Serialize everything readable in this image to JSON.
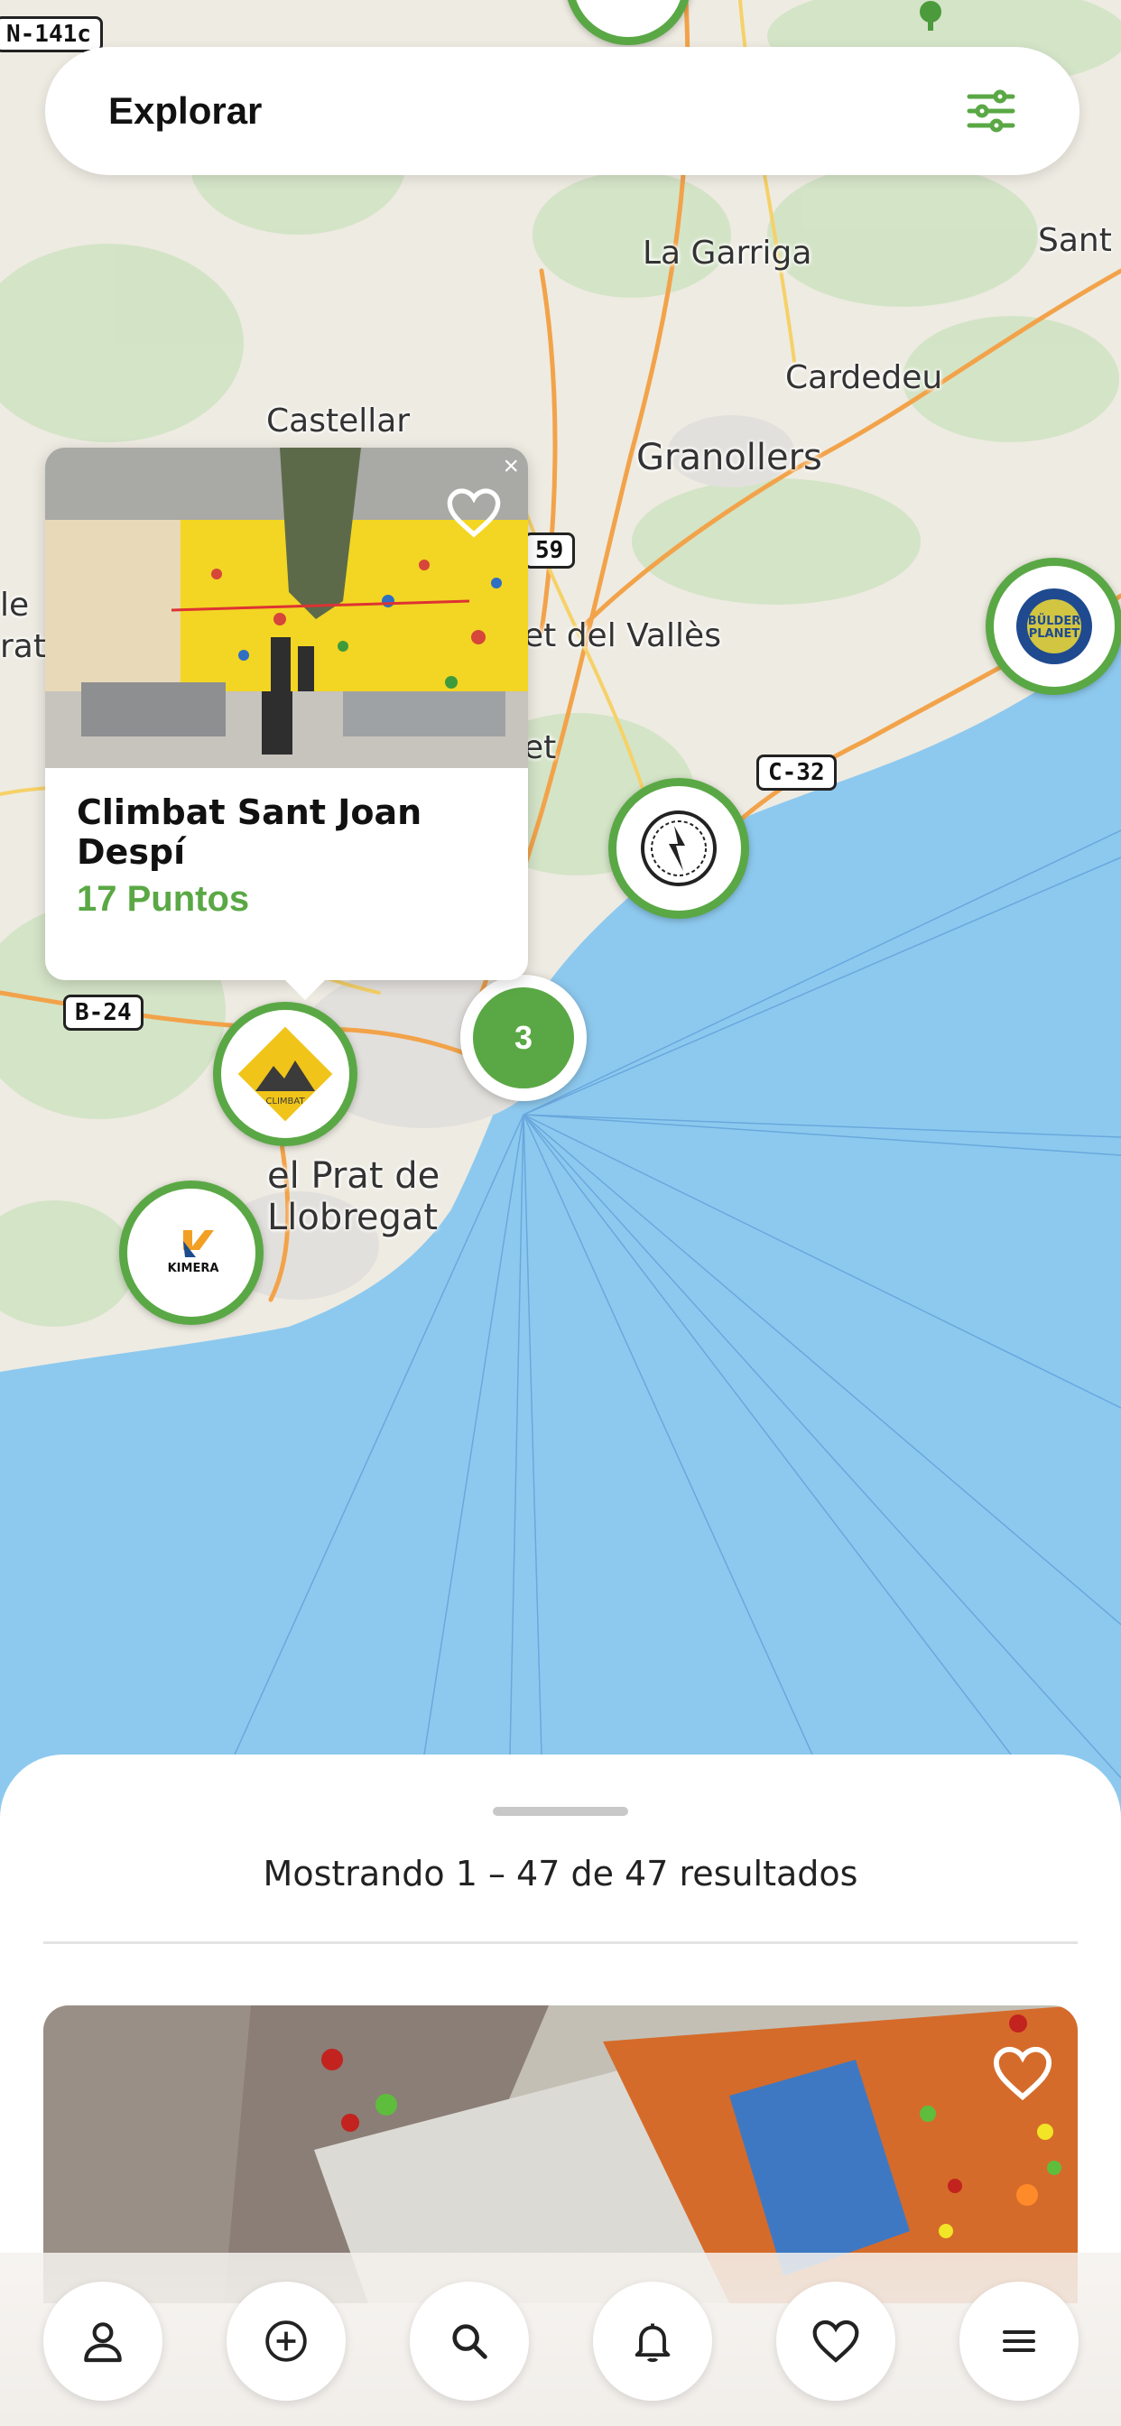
{
  "header": {
    "title": "Explorar",
    "filter_icon": "sliders-icon"
  },
  "map": {
    "place_labels": [
      "La Garriga",
      "Sant",
      "Cardedeu",
      "Castellar",
      "Granollers",
      "et del Vallès",
      "el Prat de",
      "Llobregat",
      "le",
      "rat",
      "et"
    ],
    "road_shields": [
      "N-141c",
      "59",
      "C-32",
      "B-24"
    ]
  },
  "markers": [
    {
      "name": "Bulder Planet",
      "logo_text": "BÜLDER PLANET"
    },
    {
      "name": "gym-logo-round"
    },
    {
      "name": "Climbat",
      "logo_text": "CLIMBAT"
    },
    {
      "name": "Kimera",
      "logo_text": "KIMERA"
    }
  ],
  "cluster": {
    "count": "3"
  },
  "popup": {
    "name": "Climbat Sant Joan Despí",
    "points": "17 Puntos",
    "close": "×"
  },
  "results": {
    "text": "Mostrando 1 – 47 de 47 resultados"
  },
  "nav": [
    "profile-icon",
    "add-icon",
    "search-icon",
    "bell-icon",
    "heart-icon",
    "menu-icon"
  ],
  "colors": {
    "accent": "#5aa845",
    "sea": "#8dc9ee",
    "land": "#eeebe2"
  }
}
